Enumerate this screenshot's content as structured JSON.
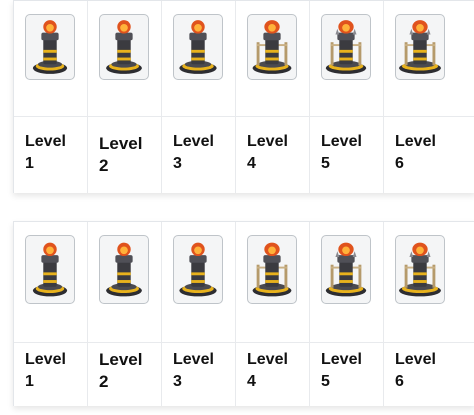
{
  "tables": [
    {
      "levels": [
        {
          "word": "Level",
          "num": "1",
          "icon": "tower-level-1-icon"
        },
        {
          "word": "Level",
          "num": "2",
          "icon": "tower-level-2-icon"
        },
        {
          "word": "Level",
          "num": "3",
          "icon": "tower-level-3-icon"
        },
        {
          "word": "Level",
          "num": "4",
          "icon": "tower-level-4-icon"
        },
        {
          "word": "Level",
          "num": "5",
          "icon": "tower-level-5-icon"
        },
        {
          "word": "Level",
          "num": "6",
          "icon": "tower-level-6-icon"
        }
      ]
    },
    {
      "levels": [
        {
          "word": "Level",
          "num": "1",
          "icon": "tower-level-1-icon"
        },
        {
          "word": "Level",
          "num": "2",
          "icon": "tower-level-2-icon"
        },
        {
          "word": "Level",
          "num": "3",
          "icon": "tower-level-3-icon"
        },
        {
          "word": "Level",
          "num": "4",
          "icon": "tower-level-4-icon"
        },
        {
          "word": "Level",
          "num": "5",
          "icon": "tower-level-5-icon"
        },
        {
          "word": "Level",
          "num": "6",
          "icon": "tower-level-6-icon"
        }
      ]
    }
  ],
  "colors": {
    "tower_stone": "#3b3b40",
    "tower_gold": "#e8b21c",
    "tower_flame": "#e0531d",
    "tower_ember": "#ffb23a"
  }
}
